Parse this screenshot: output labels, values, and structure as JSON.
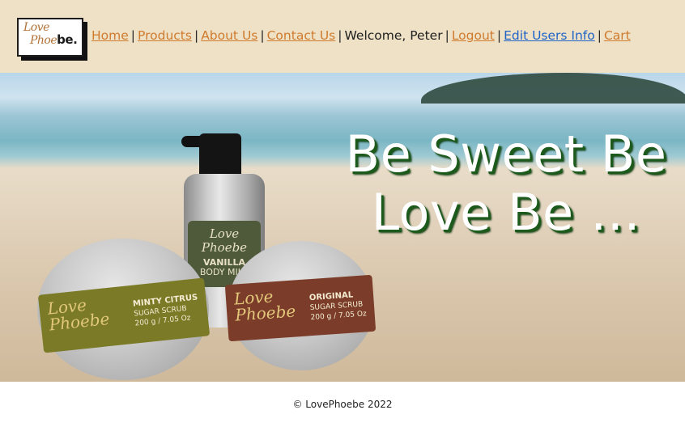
{
  "logo": {
    "line1": "Love",
    "line2": "Phoe",
    "line2_bold": "be."
  },
  "nav": {
    "home": "Home",
    "products": "Products",
    "about": "About Us",
    "contact": "Contact Us",
    "welcome": "Welcome, Peter",
    "logout": "Logout",
    "edit_users": "Edit Users Info",
    "cart": "Cart",
    "separator": "|"
  },
  "hero": {
    "headline_line1": "Be Sweet Be",
    "headline_line2": "Love Be …",
    "products": {
      "bottle_brand": "Love Phoebe",
      "bottle_name": "VANILLA",
      "bottle_sub": "BODY MILK",
      "tin_left_brand": "Love Phoebe",
      "tin_left_name": "MINTY CITRUS",
      "tin_left_sub": "SUGAR SCRUB",
      "tin_left_weight": "200 g / 7.05 Oz",
      "tin_right_brand": "Love Phoebe",
      "tin_right_name": "ORIGINAL",
      "tin_right_sub": "SUGAR SCRUB",
      "tin_right_weight": "200 g / 7.05 Oz"
    }
  },
  "footer": {
    "copyright": "© LovePhoebe 2022"
  },
  "colors": {
    "header_bg": "#efe1c6",
    "link_brown": "#cf7b2e",
    "link_blue": "#1e63c8",
    "headline_shadow": "#1c5a1c"
  }
}
